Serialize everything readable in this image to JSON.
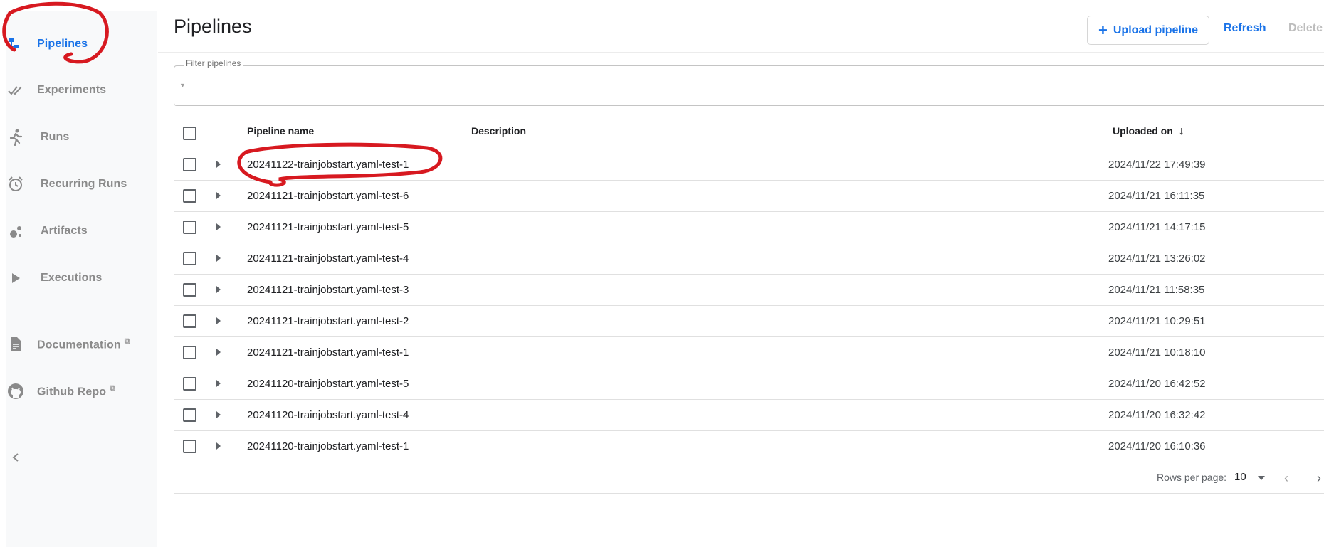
{
  "sidebar": {
    "items": [
      {
        "label": "Pipelines",
        "icon": "pipeline-icon",
        "active": true
      },
      {
        "label": "Experiments",
        "icon": "done-all-icon"
      },
      {
        "label": "Runs",
        "icon": "running-person-icon"
      },
      {
        "label": "Recurring Runs",
        "icon": "alarm-icon"
      },
      {
        "label": "Artifacts",
        "icon": "bubbles-icon"
      },
      {
        "label": "Executions",
        "icon": "play-icon"
      },
      {
        "label": "Documentation",
        "icon": "document-icon",
        "external": true
      },
      {
        "label": "Github Repo",
        "icon": "github-icon",
        "external": true
      }
    ],
    "collapse_icon": "chevron-left-icon"
  },
  "header": {
    "title": "Pipelines",
    "upload_label": "Upload pipeline",
    "refresh_label": "Refresh",
    "delete_label": "Delete"
  },
  "filter": {
    "label": "Filter pipelines"
  },
  "table": {
    "columns": {
      "name": "Pipeline name",
      "description": "Description",
      "uploaded": "Uploaded on"
    },
    "sort": "descending",
    "rows": [
      {
        "name": "20241122-trainjobstart.yaml-test-1",
        "uploaded": "2024/11/22 17:49:39"
      },
      {
        "name": "20241121-trainjobstart.yaml-test-6",
        "uploaded": "2024/11/21 16:11:35"
      },
      {
        "name": "20241121-trainjobstart.yaml-test-5",
        "uploaded": "2024/11/21 14:17:15"
      },
      {
        "name": "20241121-trainjobstart.yaml-test-4",
        "uploaded": "2024/11/21 13:26:02"
      },
      {
        "name": "20241121-trainjobstart.yaml-test-3",
        "uploaded": "2024/11/21 11:58:35"
      },
      {
        "name": "20241121-trainjobstart.yaml-test-2",
        "uploaded": "2024/11/21 10:29:51"
      },
      {
        "name": "20241121-trainjobstart.yaml-test-1",
        "uploaded": "2024/11/21 10:18:10"
      },
      {
        "name": "20241120-trainjobstart.yaml-test-5",
        "uploaded": "2024/11/20 16:42:52"
      },
      {
        "name": "20241120-trainjobstart.yaml-test-4",
        "uploaded": "2024/11/20 16:32:42"
      },
      {
        "name": "20241120-trainjobstart.yaml-test-1",
        "uploaded": "2024/11/20 16:10:36"
      }
    ]
  },
  "pagination": {
    "rows_label": "Rows per page:",
    "rows_value": "10"
  },
  "colors": {
    "accent": "#1a73e8",
    "annotation": "#d71920",
    "muted": "#8a8a8a"
  }
}
